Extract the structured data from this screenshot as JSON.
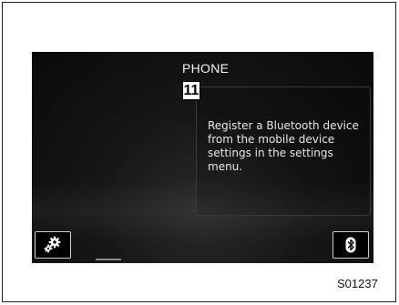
{
  "screen": {
    "title": "PHONE",
    "step_number": "11",
    "message": "Register a Bluetooth device from the mobile device settings in the settings menu."
  },
  "buttons": {
    "settings_icon": "gears-icon",
    "bluetooth_icon": "bluetooth-icon"
  },
  "figure_code": "S01237",
  "colors": {
    "screen_background": "#0a0a0a",
    "text": "#f2f2f2",
    "button_border": "#cfcfcf"
  }
}
